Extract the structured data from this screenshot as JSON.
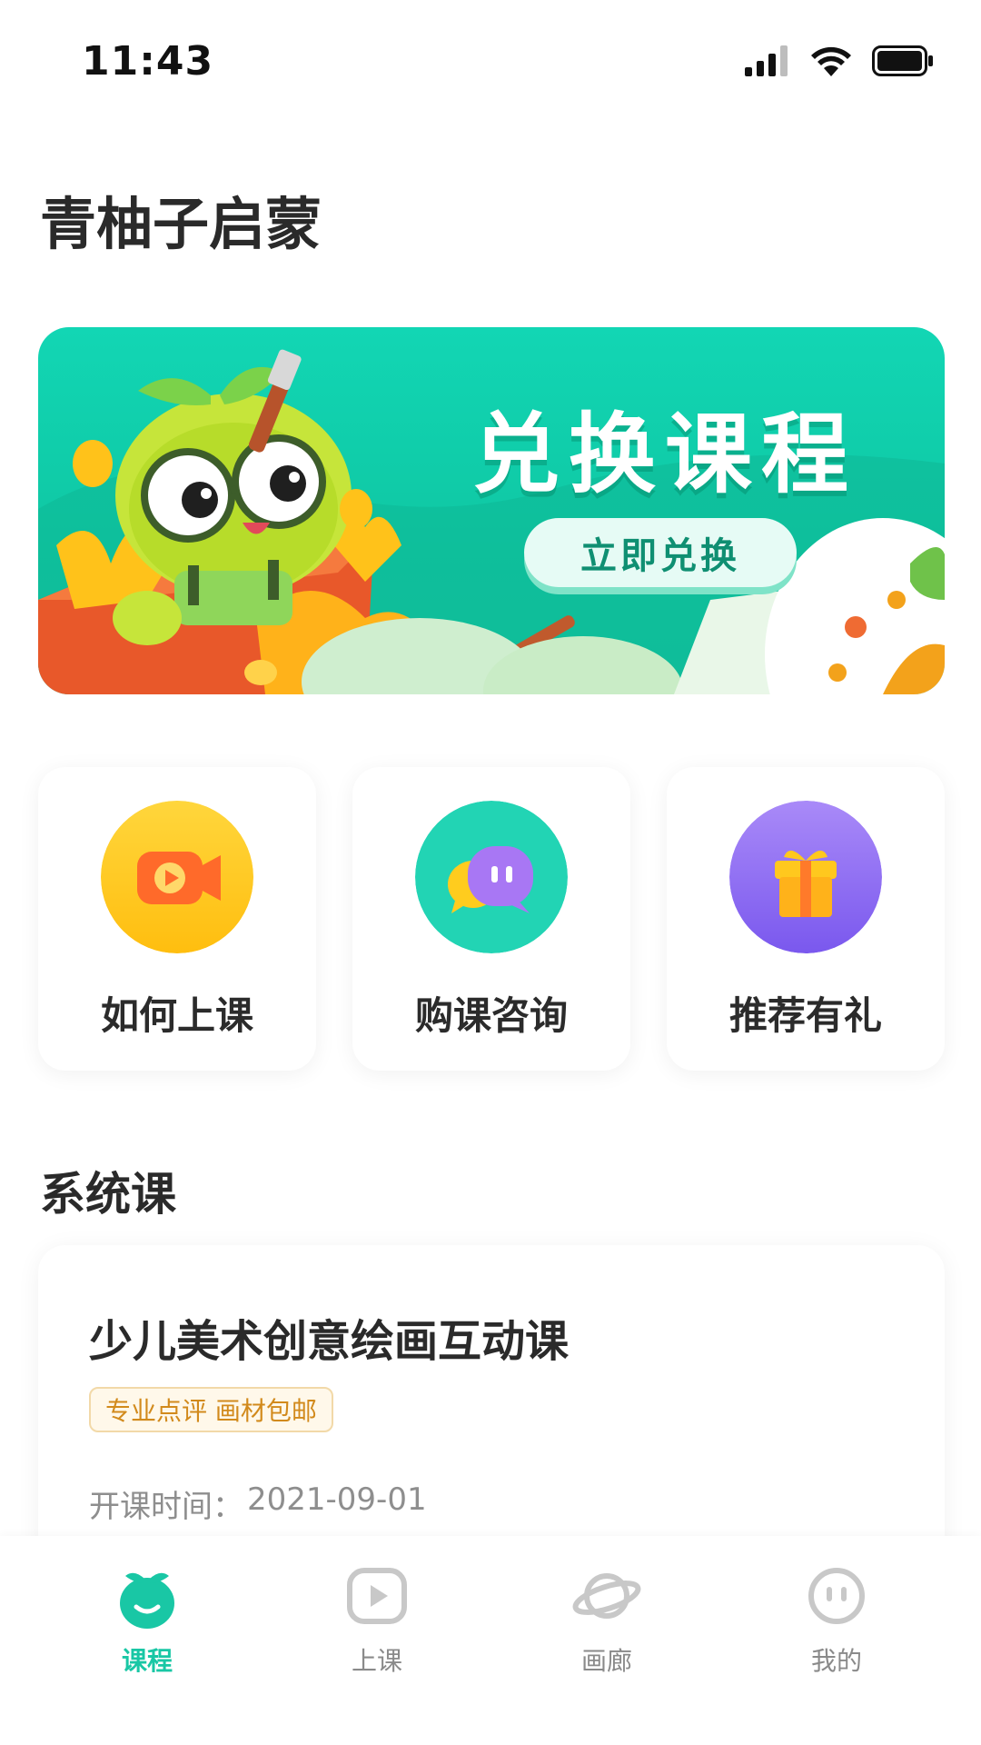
{
  "status_bar": {
    "time": "11:43"
  },
  "header": {
    "title": "青柚子启蒙"
  },
  "banner": {
    "title": "兑换课程",
    "button_label": "立即兑换"
  },
  "entries": [
    {
      "label": "如何上课",
      "icon": "video-camera-icon",
      "color": "#ffc81e"
    },
    {
      "label": "购课咨询",
      "icon": "chat-bubbles-icon",
      "color": "#22d4b4"
    },
    {
      "label": "推荐有礼",
      "icon": "gift-icon",
      "color": "#8a6bf2"
    }
  ],
  "section": {
    "title": "系统课"
  },
  "course": {
    "name": "少儿美术创意绘画互动课",
    "tag": "专业点评 画材包邮",
    "time_label": "开课时间：",
    "time_value": "2021-09-01"
  },
  "tabs": [
    {
      "label": "课程",
      "icon": "sprout-icon",
      "active": true
    },
    {
      "label": "上课",
      "icon": "play-icon",
      "active": false
    },
    {
      "label": "画廊",
      "icon": "planet-icon",
      "active": false
    },
    {
      "label": "我的",
      "icon": "face-icon",
      "active": false
    }
  ],
  "colors": {
    "accent": "#19c7a5",
    "banner": "#12d6b4"
  }
}
